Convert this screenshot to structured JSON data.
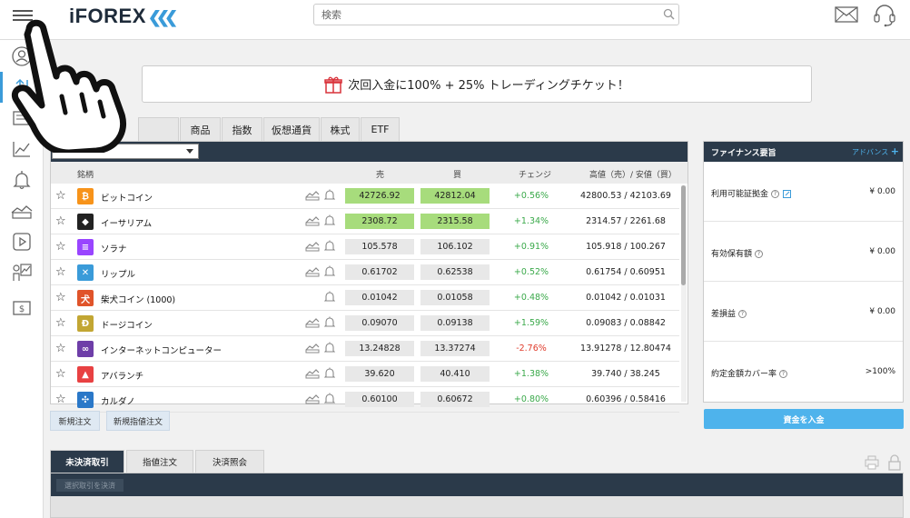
{
  "brand": {
    "logo": "iFOREX",
    "accent": "#3a9bd9",
    "navy": "#2b3a4a",
    "green": "#3aa94a",
    "red": "#e03c2c"
  },
  "header": {
    "search_placeholder": "検索",
    "icons": [
      "menu-icon",
      "search-icon",
      "mail-icon",
      "headset-icon"
    ]
  },
  "sidebar": {
    "icons": [
      "user-icon",
      "trade-arrows-icon",
      "newspaper-icon",
      "chart-line-icon",
      "bell-icon",
      "handshake-icon",
      "play-icon",
      "analyst-icon",
      "dollar-icon"
    ]
  },
  "banner": {
    "text": "次回入金に100% + 25% トレーディングチケット！"
  },
  "tabs": [
    "",
    "商品",
    "指数",
    "仮想通貨",
    "株式",
    "ETF"
  ],
  "market": {
    "columns": {
      "name": "銘柄",
      "bid": "売",
      "ask": "買",
      "change": "チェンジ",
      "highlow": "高値（売）/ 安値（買）"
    },
    "rows": [
      {
        "name": "ビットコイン",
        "coin_color": "#f7931a",
        "coin_glyph": "₿",
        "bid": "42726.92",
        "ask": "42812.04",
        "bid_hl": true,
        "ask_hl": true,
        "change": "+0.56%",
        "dir": "up",
        "highlow": "42800.53 / 42103.69",
        "signal": true
      },
      {
        "name": "イーサリアム",
        "coin_color": "#222222",
        "coin_glyph": "◆",
        "bid": "2308.72",
        "ask": "2315.58",
        "bid_hl": true,
        "ask_hl": true,
        "change": "+1.34%",
        "dir": "up",
        "highlow": "2314.57 / 2261.68",
        "signal": true
      },
      {
        "name": "ソラナ",
        "coin_color": "#9945ff",
        "coin_glyph": "≡",
        "bid": "105.578",
        "ask": "106.102",
        "bid_hl": false,
        "ask_hl": false,
        "change": "+0.91%",
        "dir": "up",
        "highlow": "105.918 / 100.267",
        "signal": true
      },
      {
        "name": "リップル",
        "coin_color": "#3a9bd9",
        "coin_glyph": "✕",
        "bid": "0.61702",
        "ask": "0.62538",
        "bid_hl": false,
        "ask_hl": false,
        "change": "+0.52%",
        "dir": "up",
        "highlow": "0.61754 / 0.60951",
        "signal": true
      },
      {
        "name": "柴犬コイン (1000)",
        "coin_color": "#e0542a",
        "coin_glyph": "犬",
        "bid": "0.01042",
        "ask": "0.01058",
        "bid_hl": false,
        "ask_hl": false,
        "change": "+0.48%",
        "dir": "up",
        "highlow": "0.01042 / 0.01031",
        "signal": false
      },
      {
        "name": "ドージコイン",
        "coin_color": "#c2a633",
        "coin_glyph": "Ð",
        "bid": "0.09070",
        "ask": "0.09138",
        "bid_hl": false,
        "ask_hl": false,
        "change": "+1.59%",
        "dir": "up",
        "highlow": "0.09083 / 0.08842",
        "signal": true
      },
      {
        "name": "インターネットコンピューター",
        "coin_color": "#6e3ea8",
        "coin_glyph": "∞",
        "bid": "13.24828",
        "ask": "13.37274",
        "bid_hl": false,
        "ask_hl": false,
        "change": "-2.76%",
        "dir": "down",
        "highlow": "13.91278 / 12.80474",
        "signal": true
      },
      {
        "name": "アバランチ",
        "coin_color": "#e84142",
        "coin_glyph": "▲",
        "bid": "39.620",
        "ask": "40.410",
        "bid_hl": false,
        "ask_hl": false,
        "change": "+1.38%",
        "dir": "up",
        "highlow": "39.740 / 38.245",
        "signal": true
      },
      {
        "name": "カルダノ",
        "coin_color": "#2a78c8",
        "coin_glyph": "✣",
        "bid": "0.60100",
        "ask": "0.60672",
        "bid_hl": false,
        "ask_hl": false,
        "change": "+0.80%",
        "dir": "up",
        "highlow": "0.60396 / 0.58416",
        "signal": true
      }
    ],
    "new_order": "新規注文",
    "new_limit_order": "新規指値注文"
  },
  "finance": {
    "title": "ファイナンス要旨",
    "advanced": "アドバンス",
    "rows": [
      {
        "label": "利用可能証拠金",
        "value": "¥ 0.00"
      },
      {
        "label": "有効保有額",
        "value": "¥ 0.00"
      },
      {
        "label": "差損益",
        "value": "¥ 0.00"
      },
      {
        "label": "約定金額カバー率",
        "value": ">100%"
      }
    ],
    "deposit": "資金を入金"
  },
  "bottom": {
    "tabs": [
      "未決済取引",
      "指値注文",
      "決済照会"
    ],
    "close_selected": "選択取引を決済"
  }
}
